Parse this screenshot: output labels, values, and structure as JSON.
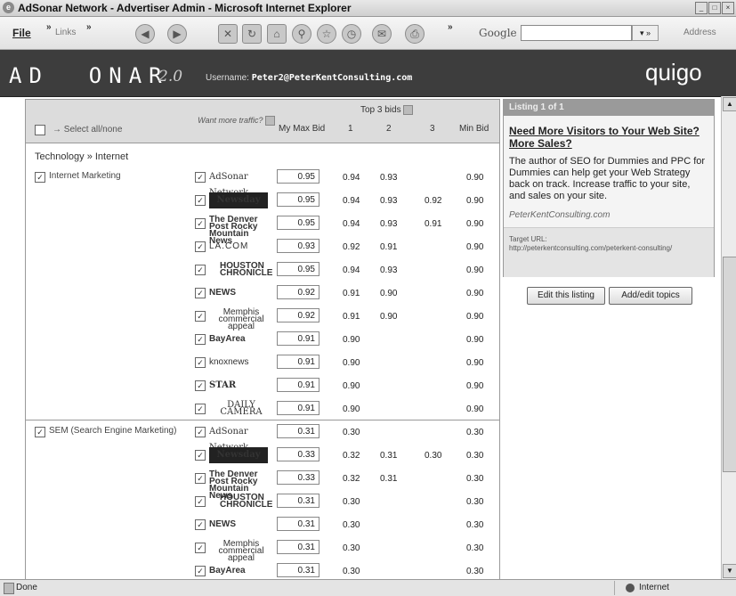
{
  "window": {
    "title": "AdSonar Network - Advertiser Admin - Microsoft Internet Explorer"
  },
  "toolbar": {
    "file_menu": "File",
    "links": "Links",
    "google": "Google",
    "address": "Address"
  },
  "banner": {
    "logo": "AD  ONAR",
    "version": "2.0",
    "username_label": "Username:",
    "username_value": "Peter2@PeterKentConsulting.com",
    "brand": "quigo"
  },
  "table_header": {
    "select_all": "Select all/none",
    "want_more": "Want more traffic?",
    "my_max_bid": "My Max Bid",
    "top3": "Top 3 bids",
    "col1": "1",
    "col2": "2",
    "col3": "3",
    "min_bid": "Min Bid"
  },
  "section": {
    "title": "Technology » Internet"
  },
  "groups": [
    {
      "topic": "Internet Marketing",
      "rows": [
        {
          "site": "AdSonar Network",
          "style": "adsonar",
          "bid": "0.95",
          "b1": "0.94",
          "b2": "0.93",
          "b3": "",
          "min": "0.90"
        },
        {
          "site": "Newsday",
          "style": "newsday",
          "bid": "0.95",
          "b1": "0.94",
          "b2": "0.93",
          "b3": "0.92",
          "min": "0.90"
        },
        {
          "site": "The Denver Post Rocky Mountain News",
          "style": "denver",
          "bid": "0.95",
          "b1": "0.94",
          "b2": "0.93",
          "b3": "0.91",
          "min": "0.90"
        },
        {
          "site": "LA.COM",
          "style": "lacom",
          "bid": "0.93",
          "b1": "0.92",
          "b2": "0.91",
          "b3": "",
          "min": "0.90"
        },
        {
          "site": "HOUSTON CHRONICLE",
          "style": "houston",
          "bid": "0.95",
          "b1": "0.94",
          "b2": "0.93",
          "b3": "",
          "min": "0.90"
        },
        {
          "site": "NEWS",
          "style": "news",
          "bid": "0.92",
          "b1": "0.91",
          "b2": "0.90",
          "b3": "",
          "min": "0.90"
        },
        {
          "site": "Memphis commercial appeal",
          "style": "memphis",
          "bid": "0.92",
          "b1": "0.91",
          "b2": "0.90",
          "b3": "",
          "min": "0.90"
        },
        {
          "site": "BayArea",
          "style": "bayarea",
          "bid": "0.91",
          "b1": "0.90",
          "b2": "",
          "b3": "",
          "min": "0.90"
        },
        {
          "site": "knoxnews",
          "style": "knox",
          "bid": "0.91",
          "b1": "0.90",
          "b2": "",
          "b3": "",
          "min": "0.90"
        },
        {
          "site": "STAR",
          "style": "star",
          "bid": "0.91",
          "b1": "0.90",
          "b2": "",
          "b3": "",
          "min": "0.90"
        },
        {
          "site": "DAILY CAMERA",
          "style": "camera",
          "bid": "0.91",
          "b1": "0.90",
          "b2": "",
          "b3": "",
          "min": "0.90"
        }
      ]
    },
    {
      "topic": "SEM (Search Engine Marketing)",
      "rows": [
        {
          "site": "AdSonar Network",
          "style": "adsonar",
          "bid": "0.31",
          "b1": "0.30",
          "b2": "",
          "b3": "",
          "min": "0.30"
        },
        {
          "site": "Newsday",
          "style": "newsday",
          "bid": "0.33",
          "b1": "0.32",
          "b2": "0.31",
          "b3": "0.30",
          "min": "0.30"
        },
        {
          "site": "The Denver Post Rocky Mountain News",
          "style": "denver",
          "bid": "0.33",
          "b1": "0.32",
          "b2": "0.31",
          "b3": "",
          "min": "0.30"
        },
        {
          "site": "HOUSTON CHRONICLE",
          "style": "houston",
          "bid": "0.31",
          "b1": "0.30",
          "b2": "",
          "b3": "",
          "min": "0.30"
        },
        {
          "site": "NEWS",
          "style": "news",
          "bid": "0.31",
          "b1": "0.30",
          "b2": "",
          "b3": "",
          "min": "0.30"
        },
        {
          "site": "Memphis commercial appeal",
          "style": "memphis",
          "bid": "0.31",
          "b1": "0.30",
          "b2": "",
          "b3": "",
          "min": "0.30"
        },
        {
          "site": "BayArea",
          "style": "bayarea",
          "bid": "0.31",
          "b1": "0.30",
          "b2": "",
          "b3": "",
          "min": "0.30"
        }
      ]
    }
  ],
  "listing": {
    "header": "Listing 1 of 1",
    "headline": "Need More Visitors to Your Web Site? More Sales?",
    "body": "The author of SEO for Dummies and PPC for Dummies can help get your Web Strategy back on track. Increase traffic to your site, and sales on your site.",
    "display_url": "PeterKentConsulting.com",
    "target_label": "Target URL:",
    "target_url": "http://peterkentconsulting.com/peterkent-consulting/",
    "edit_button": "Edit this listing",
    "topics_button": "Add/edit topics"
  },
  "status": {
    "left": "Done",
    "zone": "Internet"
  }
}
